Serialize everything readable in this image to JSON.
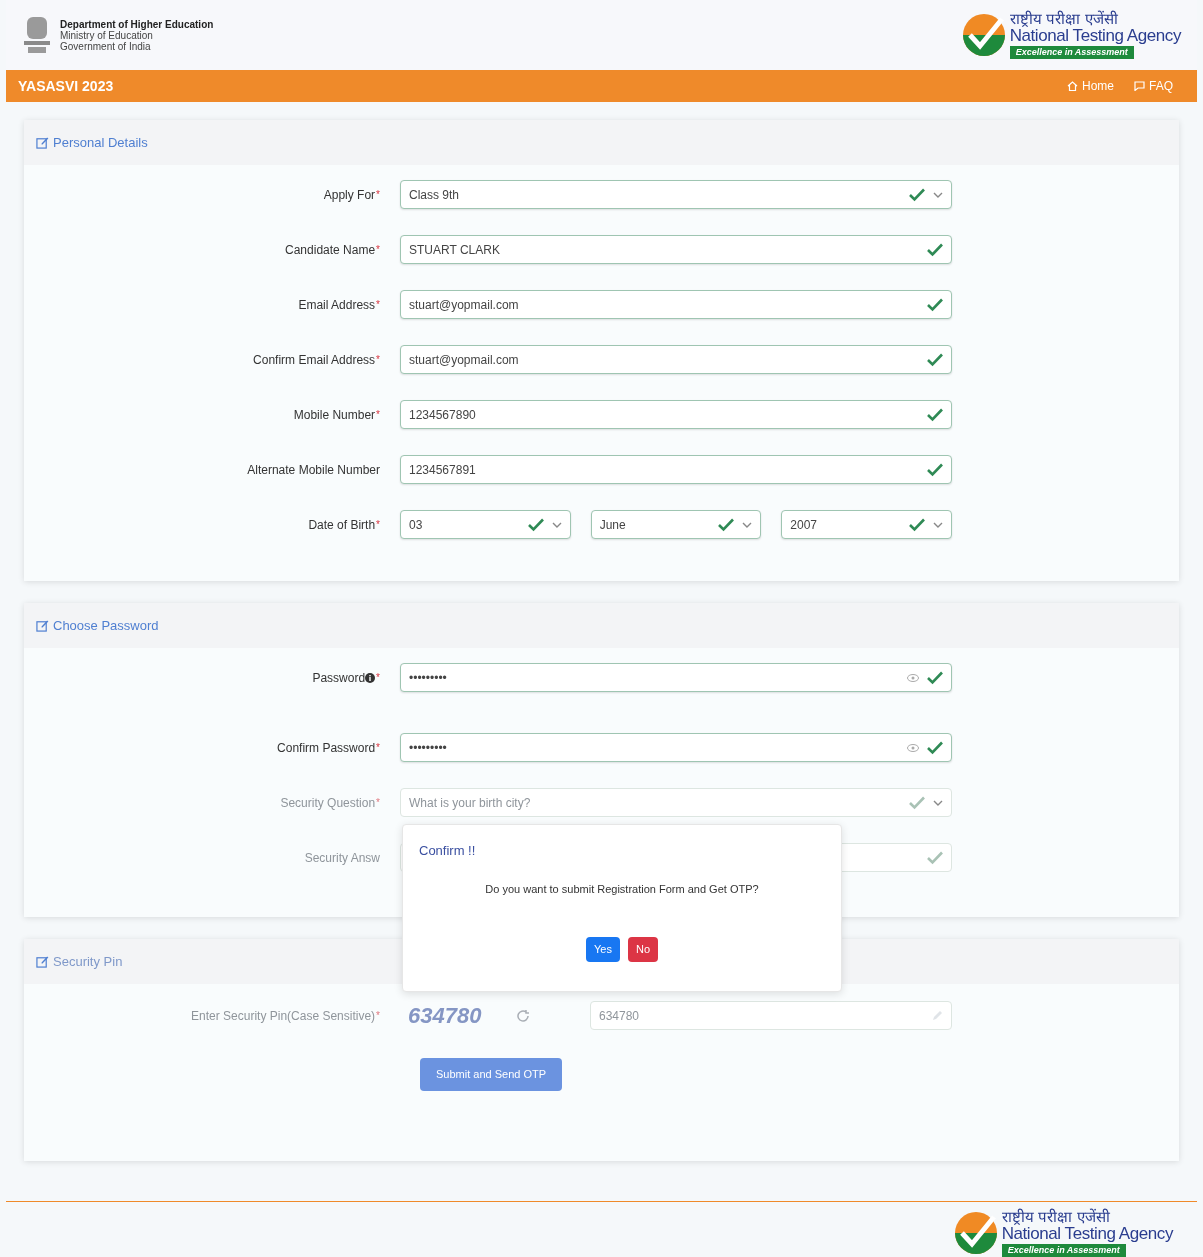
{
  "header": {
    "department": "Department of Higher Education",
    "ministry": "Ministry of Education",
    "government": "Government of India",
    "agency_hindi": "राष्ट्रीय परीक्षा एजेंसी",
    "agency": "National Testing Agency",
    "agency_tagline": "Excellence in Assessment"
  },
  "navbar": {
    "title": "YASASVI 2023",
    "links": [
      {
        "label": "Home",
        "kind": "home"
      },
      {
        "label": "FAQ",
        "kind": "faq"
      }
    ]
  },
  "sections": [
    {
      "title": "Personal Details",
      "fields": [
        {
          "label": "Apply For",
          "required": "*",
          "kind": "select",
          "value": "Class 9th",
          "valid": true,
          "dimmed": false
        },
        {
          "label": "Candidate Name",
          "required": "*",
          "kind": "text",
          "value": "STUART CLARK",
          "valid": true,
          "dimmed": false
        },
        {
          "label": "Email Address",
          "required": "*",
          "kind": "text",
          "value": "stuart@yopmail.com",
          "valid": true,
          "dimmed": false
        },
        {
          "label": "Confirm Email Address",
          "required": "*",
          "kind": "text",
          "value": "stuart@yopmail.com",
          "valid": true,
          "dimmed": false
        },
        {
          "label": "Mobile Number",
          "required": "*",
          "kind": "text",
          "value": "1234567890",
          "valid": true,
          "dimmed": false
        },
        {
          "label": "Alternate Mobile Number",
          "kind": "text",
          "value": "1234567891",
          "valid": true,
          "dimmed": false
        },
        {
          "label": "Date of Birth",
          "required": "*",
          "kind": "date",
          "parts": [
            "03",
            "June",
            "2007"
          ],
          "valid": true,
          "dimmed": false
        }
      ]
    },
    {
      "title": "Choose Password",
      "fields": [
        {
          "label": "Password",
          "required": "*",
          "info": true,
          "kind": "password",
          "value": "•••••••••",
          "valid": true,
          "dimmed": false
        },
        {
          "label": "Confirm Password",
          "required": "*",
          "kind": "password",
          "value": "•••••••••",
          "valid": true,
          "dimmed": false
        },
        {
          "label": "Security Question",
          "required": "*",
          "kind": "select",
          "value": "What is your birth city?",
          "valid": true,
          "dimmed": true
        },
        {
          "label": "Security Answ",
          "kind": "text",
          "valid": true,
          "dimmed": true
        }
      ]
    },
    {
      "title": "Security Pin",
      "dimmed": true,
      "fields": [
        {
          "label": "Enter Security Pin(Case Sensitive)",
          "required": "*",
          "kind": "captcha",
          "captcha": "634780",
          "value": "634780",
          "dimmed": true
        }
      ],
      "button": "Submit and Send OTP"
    }
  ],
  "dialog": {
    "title": "Confirm !!",
    "message": "Do you want to submit Registration Form and Get OTP?",
    "buttons": [
      {
        "label": "Yes",
        "kind": "primary"
      },
      {
        "label": "No",
        "kind": "danger"
      }
    ]
  },
  "footer": {
    "agency_hindi": "राष्ट्रीय परीक्षा एजेंसी",
    "agency": "National Testing Agency",
    "agency_tagline": "Excellence in Assessment"
  }
}
